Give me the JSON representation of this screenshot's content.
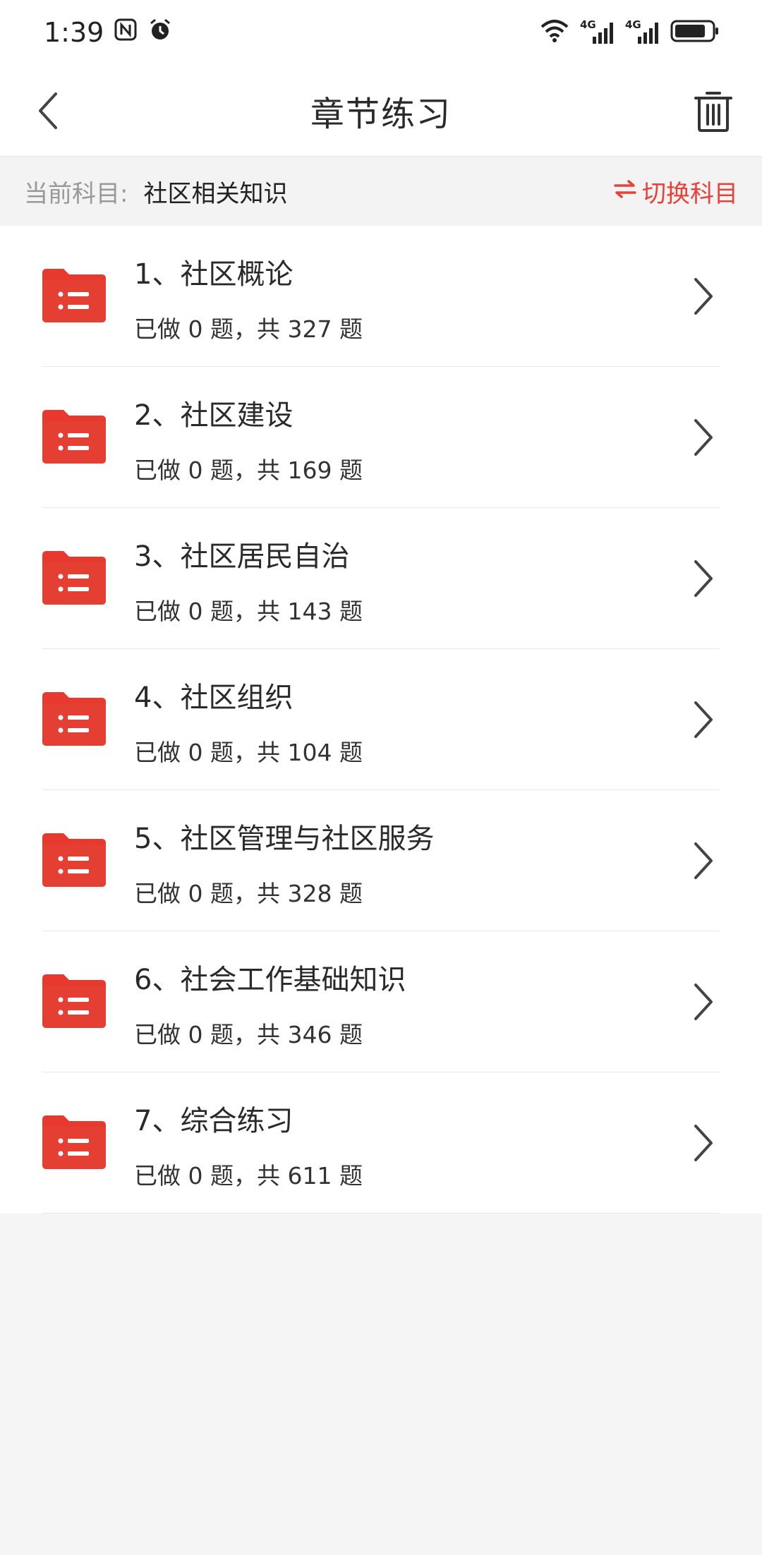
{
  "status": {
    "time": "1:39",
    "nfc_icon": "nfc-icon",
    "alarm_icon": "alarm-icon",
    "network1": "4G",
    "network2": "4G"
  },
  "navbar": {
    "title": "章节练习",
    "back_icon": "chevron-left-icon",
    "trash_icon": "trash-icon"
  },
  "subject": {
    "label": "当前科目:",
    "value": "社区相关知识",
    "switch_label": "切换科目",
    "switch_icon": "swap-icon",
    "accent": "#e8413a"
  },
  "chapters": [
    {
      "title": "1、社区概论",
      "progress": "已做 0 题，共 327 题"
    },
    {
      "title": "2、社区建设",
      "progress": "已做 0 题，共 169 题"
    },
    {
      "title": "3、社区居民自治",
      "progress": "已做 0 题，共 143 题"
    },
    {
      "title": "4、社区组织",
      "progress": "已做 0 题，共 104 题"
    },
    {
      "title": "5、社区管理与社区服务",
      "progress": "已做 0 题，共 328 题"
    },
    {
      "title": "6、社会工作基础知识",
      "progress": "已做 0 题，共 346 题"
    },
    {
      "title": "7、综合练习",
      "progress": "已做 0 题，共 611 题"
    }
  ]
}
